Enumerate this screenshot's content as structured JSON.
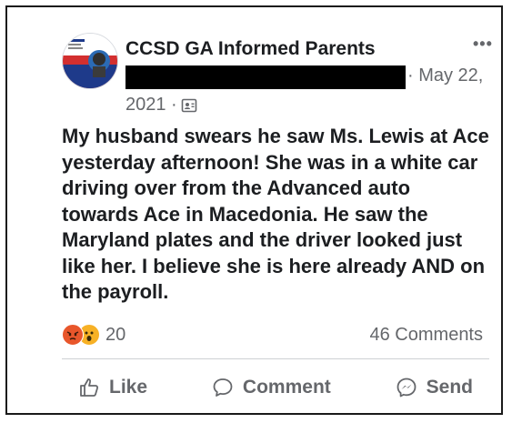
{
  "post": {
    "group_name": "CCSD GA Informed Parents",
    "more_label": "•••",
    "date_part1": "· May 22,",
    "date_part2": "2021 ·",
    "text": "My husband swears he saw Ms. Lewis at Ace yesterday afternoon! She was in a white car driving over from the Advanced auto towards Ace in Macedonia. He saw the Maryland plates and the driver looked just like her. I believe she is here already AND on the payroll."
  },
  "reactions": {
    "count": "20",
    "types": [
      "angry-icon",
      "wow-icon"
    ]
  },
  "comments": {
    "count_label": "46 Comments"
  },
  "actions": {
    "like_label": "Like",
    "comment_label": "Comment",
    "send_label": "Send"
  },
  "colors": {
    "text_primary": "#1c1e21",
    "text_secondary": "#65676b",
    "angry": "#e8562b",
    "wow": "#f7b125"
  }
}
